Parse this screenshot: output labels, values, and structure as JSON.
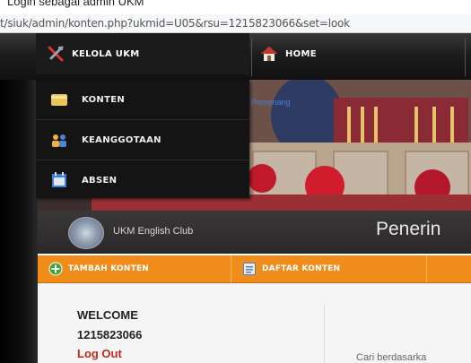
{
  "caption": "Login sebagai admin UKM",
  "url": "t/siuk/admin/konten.php?ukmid=U05&rsu=1215823066&set=look",
  "nav": {
    "kelola_label": "KELOLA UKM",
    "home_label": "HOME"
  },
  "dropdown": {
    "items": [
      {
        "label": "KONTEN",
        "icon": "folder-icon"
      },
      {
        "label": "KEANGGOTAAN",
        "icon": "users-icon"
      },
      {
        "label": "ABSEN",
        "icon": "calendar-icon"
      }
    ]
  },
  "header": {
    "club_name": "UKM English Club",
    "title": "Penerin"
  },
  "toolbar": {
    "add_label": "TAMBAH KONTEN",
    "list_label": "DAFTAR KONTEN"
  },
  "sidebar": {
    "welcome": "WELCOME",
    "user_id": "1215823066",
    "logout": "Log Out"
  },
  "main": {
    "search_text": "Cari berdasarka"
  },
  "colors": {
    "nav_bg": "#1c1c1c",
    "toolbar": "#f08c1a",
    "logout": "#c0281e"
  }
}
